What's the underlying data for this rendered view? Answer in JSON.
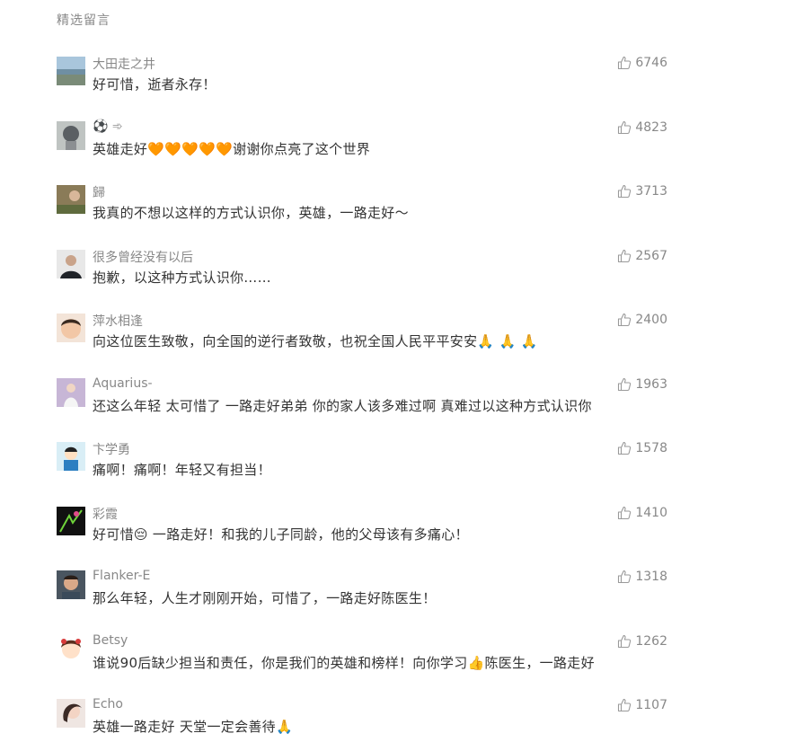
{
  "section_title": "精选留言",
  "comments": [
    {
      "nickname": "大田走之井",
      "text": "好可惜，逝者永存！",
      "likes": "6746"
    },
    {
      "nickname": "⚽ ➾",
      "text": "英雄走好🧡🧡🧡🧡🧡谢谢你点亮了这个世界",
      "likes": "4823"
    },
    {
      "nickname": "歸",
      "text": "我真的不想以这样的方式认识你，英雄，一路走好～",
      "likes": "3713"
    },
    {
      "nickname": "很多曾经没有以后",
      "text": "抱歉，以这种方式认识你……",
      "likes": "2567"
    },
    {
      "nickname": "萍水相逢",
      "text": "向这位医生致敬，向全国的逆行者致敬，也祝全国人民平平安安🙏 🙏 🙏",
      "likes": "2400"
    },
    {
      "nickname": "Aquarius-",
      "text": "还这么年轻   太可惜了    一路走好弟弟   你的家人该多难过啊   真难过以这种方式认识你",
      "likes": "1963"
    },
    {
      "nickname": "卞学勇",
      "text": "痛啊！痛啊！年轻又有担当！",
      "likes": "1578"
    },
    {
      "nickname": "彩霞",
      "text": "好可惜😔 一路走好！和我的儿子同龄，他的父母该有多痛心！",
      "likes": "1410"
    },
    {
      "nickname": "Flanker-E",
      "text": "那么年轻，人生才刚刚开始，可惜了，一路走好陈医生！",
      "likes": "1318"
    },
    {
      "nickname": "Betsy",
      "text": "谁说90后缺少担当和责任，你是我们的英雄和榜样！向你学习👍陈医生，一路走好",
      "likes": "1262"
    },
    {
      "nickname": "Echo",
      "text": "英雄一路走好  天堂一定会善待🙏",
      "likes": "1107"
    }
  ],
  "icons": {
    "like": "thumbs-up-icon"
  },
  "colors": {
    "meta_text": "#888888",
    "body_text": "#333333",
    "icon": "#9a9a9a"
  }
}
